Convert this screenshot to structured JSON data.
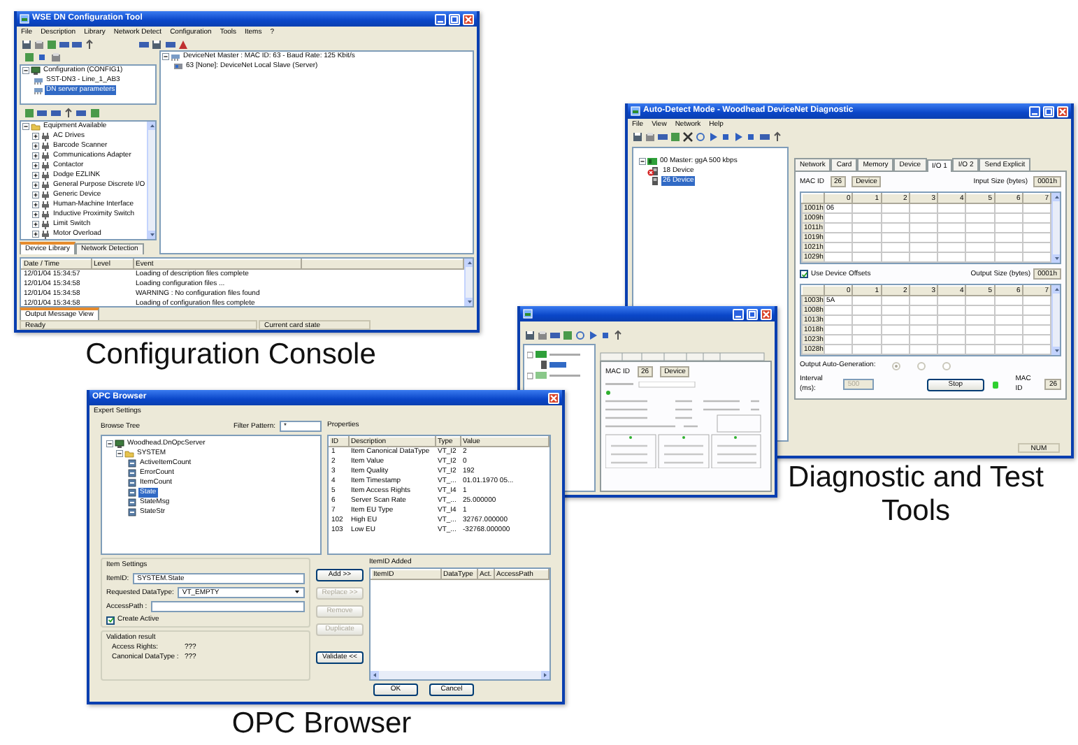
{
  "config_console": {
    "title": "WSE DN Configuration Tool",
    "menu": [
      "File",
      "Description",
      "Library",
      "Network Detect",
      "Configuration",
      "Tools",
      "Items",
      "?"
    ],
    "configuration_tree": [
      {
        "label": "Configuration (CONFIG1)",
        "expanded": true,
        "selected": false,
        "children": [
          {
            "label": "SST-DN3 - Line_1_AB3",
            "selected": false
          },
          {
            "label": "DN server parameters",
            "selected": true
          }
        ]
      }
    ],
    "equipment_tree": [
      {
        "label": "Equipment Available",
        "expanded": true,
        "selected": false,
        "children": [
          {
            "label": "AC Drives",
            "expanded": false,
            "selected": false
          },
          {
            "label": "Barcode Scanner",
            "expanded": false,
            "selected": false
          },
          {
            "label": "Communications Adapter",
            "expanded": false,
            "selected": false
          },
          {
            "label": "Contactor",
            "expanded": false,
            "selected": false
          },
          {
            "label": "Dodge EZLINK",
            "expanded": false,
            "selected": false
          },
          {
            "label": "General Purpose Discrete I/O",
            "expanded": false,
            "selected": false
          },
          {
            "label": "Generic Device",
            "expanded": false,
            "selected": false
          },
          {
            "label": "Human-Machine Interface",
            "expanded": false,
            "selected": false
          },
          {
            "label": "Inductive Proximity Switch",
            "expanded": false,
            "selected": false
          },
          {
            "label": "Limit Switch",
            "expanded": false,
            "selected": false
          },
          {
            "label": "Motor Overload",
            "expanded": false,
            "selected": false
          }
        ]
      }
    ],
    "library_tabs": [
      {
        "label": "Device Library",
        "selected": true
      },
      {
        "label": "Network Detection",
        "selected": false
      }
    ],
    "network_tree": [
      {
        "label": "DeviceNet Master : MAC ID: 63 - Baud Rate: 125 Kbit/s",
        "expanded": true,
        "selected": false,
        "children": [
          {
            "label": "63 [None]: DeviceNet Local Slave (Server)",
            "selected": false
          }
        ]
      }
    ],
    "log": {
      "columns": [
        "Date / Time",
        "Level",
        "Event"
      ],
      "rows": [
        {
          "time": "12/01/04 15:34:57",
          "event": "Loading of description files complete"
        },
        {
          "time": "12/01/04 15:34:58",
          "event": "Loading configuration files ..."
        },
        {
          "time": "12/01/04 15:34:58",
          "event": "WARNING : No configuration files found"
        },
        {
          "time": "12/01/04 15:34:58",
          "event": "Loading of configuration files complete"
        }
      ]
    },
    "log_tabs": [
      {
        "label": "Output Message View",
        "selected": true
      }
    ],
    "status_bar": [
      "Ready",
      "Current card state"
    ]
  },
  "config_caption": "Configuration Console",
  "diagnostic": {
    "title": "Auto-Detect Mode - Woodhead DeviceNet Diagnostic",
    "menu": [
      "File",
      "View",
      "Network",
      "Help"
    ],
    "device_tree": [
      {
        "label": "00 Master: ggA 500 kbps",
        "expanded": true,
        "selected": false,
        "children": [
          {
            "label": "18 Device",
            "selected": false,
            "error": true
          },
          {
            "label": "26 Device",
            "selected": true,
            "error": false
          }
        ]
      }
    ],
    "tabs": [
      {
        "label": "Network",
        "selected": false
      },
      {
        "label": "Card",
        "selected": false
      },
      {
        "label": "Memory",
        "selected": false
      },
      {
        "label": "Device",
        "selected": false
      },
      {
        "label": "I/O 1",
        "selected": true
      },
      {
        "label": "I/O 2",
        "selected": false
      },
      {
        "label": "Send Explicit",
        "selected": false
      }
    ],
    "mac_id_label": "MAC ID",
    "mac_id": "26",
    "device_name": "Device",
    "input_size_label": "Input Size (bytes)",
    "input_size": "0001h",
    "columns": [
      "0",
      "1",
      "2",
      "3",
      "4",
      "5",
      "6",
      "7"
    ],
    "input_rows": [
      {
        "label": "1001h",
        "values": [
          "06"
        ]
      },
      {
        "label": "1009h"
      },
      {
        "label": "1011h"
      },
      {
        "label": "1019h"
      },
      {
        "label": "1021h"
      },
      {
        "label": "1029h"
      }
    ],
    "use_offsets": {
      "label": "Use Device Offsets",
      "checked": true
    },
    "output_size_label": "Output Size (bytes)",
    "output_size": "0001h",
    "output_columns": [
      "0",
      "1",
      "2",
      "3",
      "4",
      "5",
      "6",
      "7"
    ],
    "output_rows": [
      {
        "label": "1003h",
        "values": [
          "5A"
        ]
      },
      {
        "label": "1008h"
      },
      {
        "label": "1013h"
      },
      {
        "label": "1018h"
      },
      {
        "label": "1023h"
      },
      {
        "label": "1028h"
      }
    ],
    "auto_generation": {
      "label": "Output Auto-Generation:",
      "options": [
        {
          "selected": true,
          "disabled": true
        },
        {
          "selected": false,
          "disabled": true
        },
        {
          "selected": false,
          "disabled": true
        }
      ]
    },
    "interval_label": "Interval (ms):",
    "interval": "500",
    "interval_disabled": true,
    "stop_button": "Stop",
    "led_on": true,
    "mac_label": "MAC ID",
    "mac_value": "26",
    "status_bar": [
      "NUM"
    ]
  },
  "diagnostic_caption": "Diagnostic and Test Tools",
  "remote_window": {
    "fields": [
      "MAC ID",
      "26",
      "Device"
    ]
  },
  "opc_browser": {
    "title": "OPC Browser",
    "menu": [
      "Expert Settings"
    ],
    "browse_label": "Browse Tree",
    "filter_label": "Filter Pattern:",
    "filter_value": "*",
    "browse_tree": [
      {
        "label": "Woodhead.DnOpcServer",
        "expanded": true,
        "selected": false,
        "children": [
          {
            "label": "SYSTEM",
            "expanded": true,
            "selected": false,
            "children": [
              {
                "label": "ActiveItemCount",
                "selected": false
              },
              {
                "label": "ErrorCount",
                "selected": false
              },
              {
                "label": "ItemCount",
                "selected": false
              },
              {
                "label": "State",
                "selected": true
              },
              {
                "label": "StateMsg",
                "selected": false
              },
              {
                "label": "StateStr",
                "selected": false
              }
            ]
          }
        ]
      }
    ],
    "properties_label": "Properties",
    "properties": {
      "columns": [
        "ID",
        "Description",
        "Type",
        "Value"
      ],
      "rows": [
        [
          "1",
          "Item Canonical DataType",
          "VT_I2",
          "2"
        ],
        [
          "2",
          "Item Value",
          "VT_I2",
          "0"
        ],
        [
          "3",
          "Item Quality",
          "VT_I2",
          "192"
        ],
        [
          "4",
          "Item Timestamp",
          "VT_...",
          "01.01.1970 05..."
        ],
        [
          "5",
          "Item Access Rights",
          "VT_I4",
          "1"
        ],
        [
          "6",
          "Server Scan Rate",
          "VT_...",
          "25.000000"
        ],
        [
          "7",
          "Item EU Type",
          "VT_I4",
          "1"
        ],
        [
          "102",
          "High EU",
          "VT_...",
          "32767.000000"
        ],
        [
          "103",
          "Low EU",
          "VT_...",
          "-32768.000000"
        ]
      ]
    },
    "item_settings_label": "Item Settings",
    "item_id_label": "ItemID:",
    "item_id": "SYSTEM.State",
    "datatype_label": "Requested DataType:",
    "datatype": "VT_EMPTY",
    "access_path_label": "AccessPath :",
    "create_active": {
      "label": "Create Active",
      "checked": true
    },
    "validation_label": "Validation result",
    "validation": [
      {
        "label": "Access Rights:",
        "value": "???"
      },
      {
        "label": "Canonical DataType :",
        "value": "???"
      }
    ],
    "side_buttons": [
      {
        "label": "Add >>",
        "disabled": false
      },
      {
        "label": "Replace >>",
        "disabled": true
      },
      {
        "label": "Remove",
        "disabled": true
      },
      {
        "label": "Duplicate",
        "disabled": true
      }
    ],
    "validate_button": "Validate <<",
    "added_label": "ItemID Added",
    "added_columns": [
      "ItemID",
      "DataType",
      "Act.",
      "AccessPath"
    ],
    "buttons": [
      "OK",
      "Cancel"
    ]
  },
  "opc_caption": "OPC Browser"
}
